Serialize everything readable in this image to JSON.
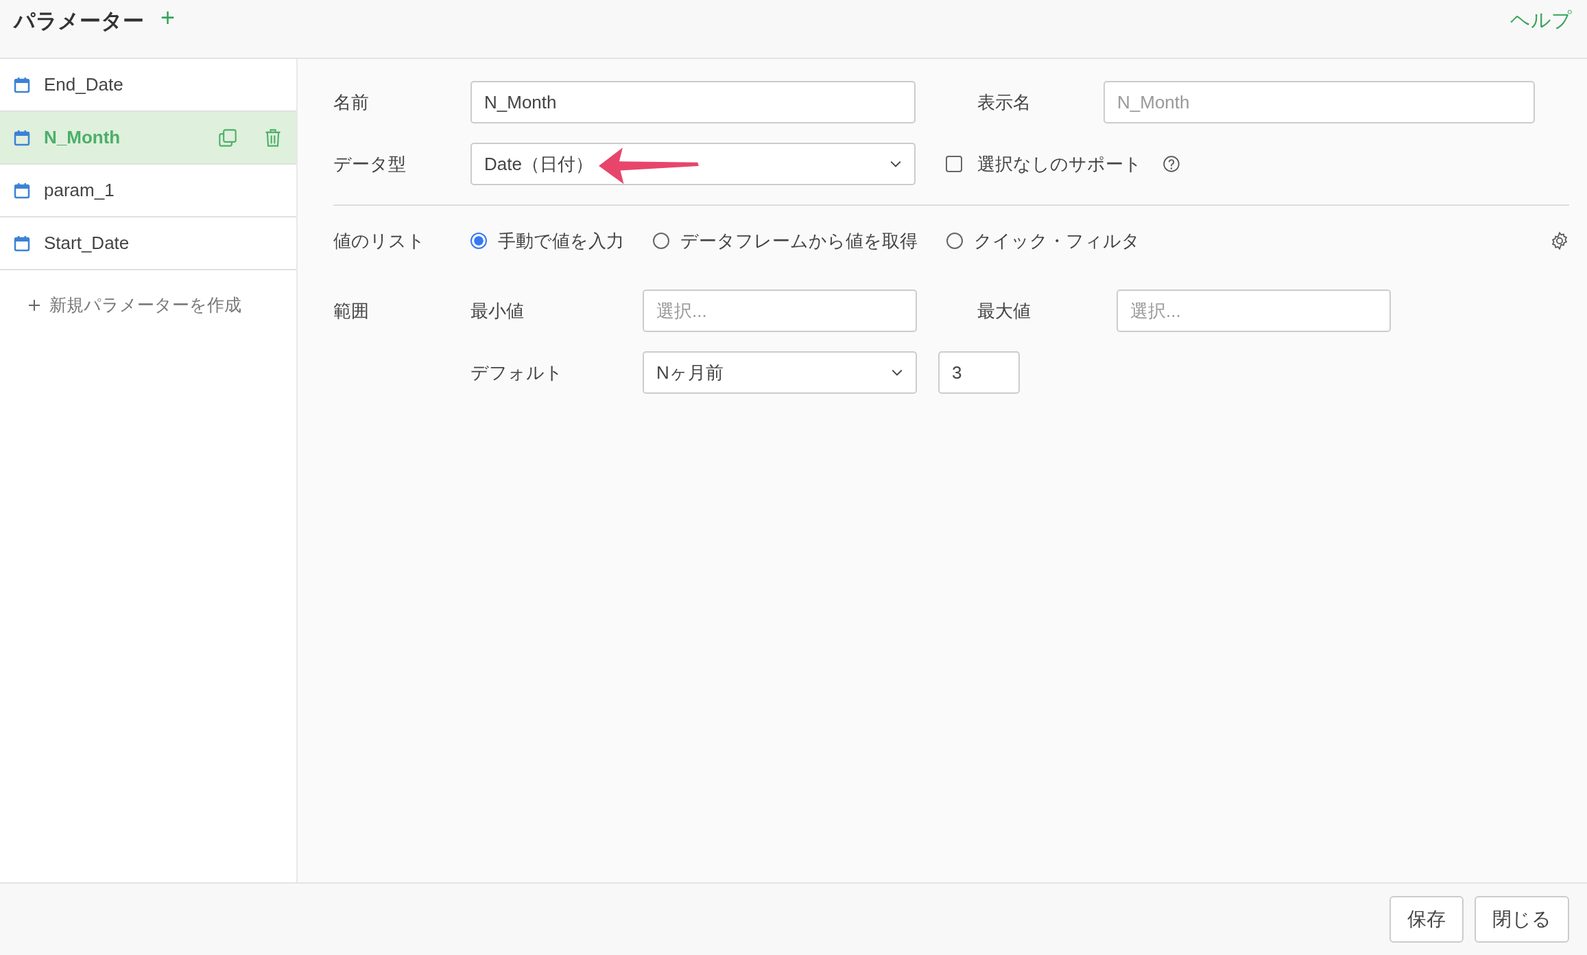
{
  "header": {
    "title": "パラメーター",
    "add_icon": "+",
    "help_link": "ヘルプ"
  },
  "sidebar": {
    "items": [
      {
        "label": "End_Date",
        "selected": false
      },
      {
        "label": "N_Month",
        "selected": true
      },
      {
        "label": "param_1",
        "selected": false
      },
      {
        "label": "Start_Date",
        "selected": false
      }
    ],
    "create_link": "新規パラメーターを作成"
  },
  "form": {
    "name": {
      "label": "名前",
      "value": "N_Month"
    },
    "display_name": {
      "label": "表示名",
      "placeholder": "N_Month"
    },
    "data_type": {
      "label": "データ型",
      "value": "Date（日付）"
    },
    "support_none": {
      "label": "選択なしのサポート",
      "checked": false
    },
    "value_list": {
      "label": "値のリスト",
      "options": [
        {
          "label": "手動で値を入力",
          "selected": true
        },
        {
          "label": "データフレームから値を取得",
          "selected": false
        },
        {
          "label": "クイック・フィルタ",
          "selected": false
        }
      ]
    },
    "range": {
      "label": "範囲",
      "min": {
        "label": "最小値",
        "placeholder": "選択..."
      },
      "max": {
        "label": "最大値",
        "placeholder": "選択..."
      }
    },
    "default": {
      "label": "デフォルト",
      "value": "Nヶ月前",
      "number": "3"
    }
  },
  "footer": {
    "buttons": [
      "保存",
      "閉じる"
    ]
  }
}
